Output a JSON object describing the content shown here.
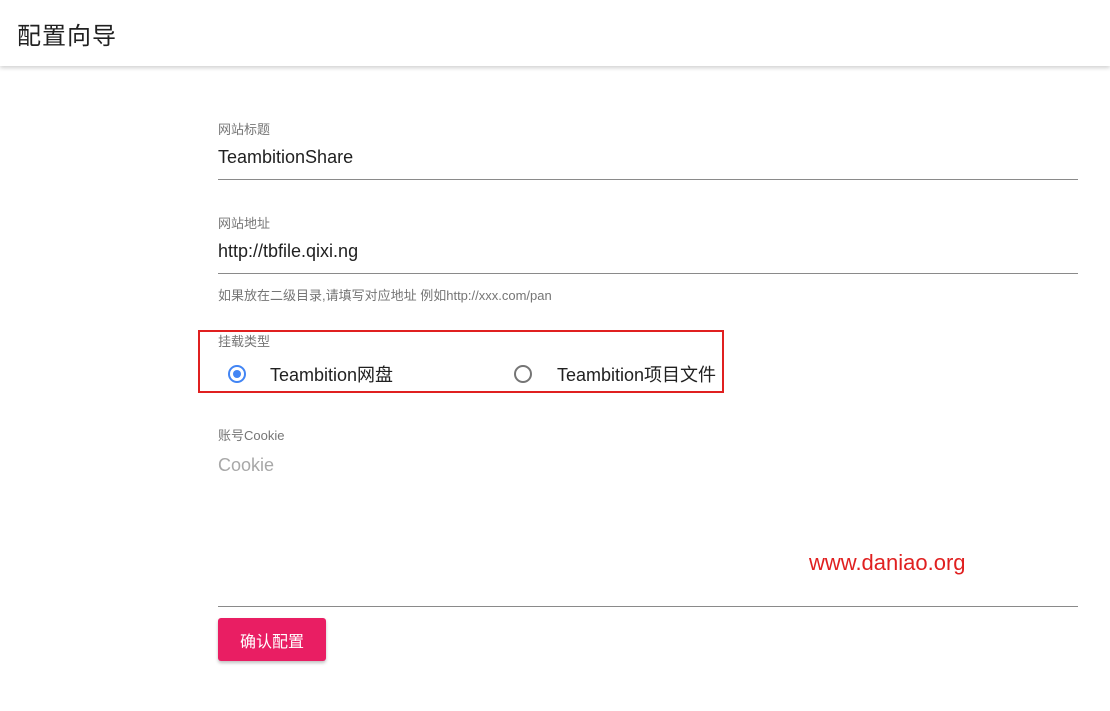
{
  "header": {
    "title": "配置向导"
  },
  "fields": {
    "site_title": {
      "label": "网站标题",
      "value": "TeambitionShare"
    },
    "site_url": {
      "label": "网站地址",
      "value": "http://tbfile.qixi.ng",
      "hint": "如果放在二级目录,请填写对应地址 例如http://xxx.com/pan"
    },
    "mount_type": {
      "label": "挂载类型",
      "options": [
        {
          "label": "Teambition网盘",
          "checked": true
        },
        {
          "label": "Teambition项目文件",
          "checked": false
        }
      ]
    },
    "cookie": {
      "label": "账号Cookie",
      "placeholder": "Cookie"
    }
  },
  "watermark": "www.daniao.org",
  "actions": {
    "confirm_label": "确认配置"
  },
  "colors": {
    "accent": "#e91e63",
    "radio_checked": "#4285f4",
    "highlight": "#e02020"
  }
}
